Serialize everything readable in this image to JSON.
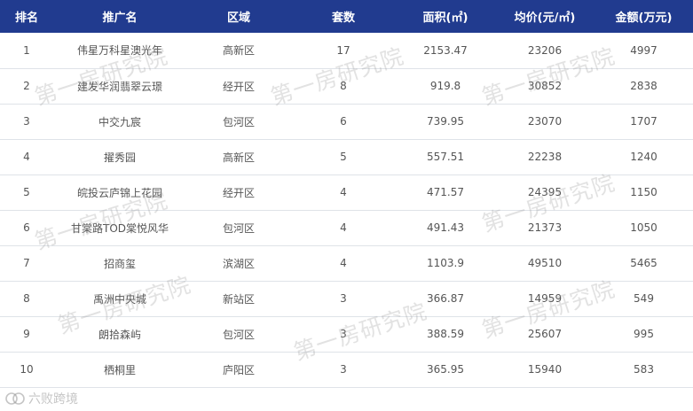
{
  "table": {
    "headers": [
      "排名",
      "推广名",
      "区域",
      "套数",
      "面积(㎡)",
      "均价(元/㎡)",
      "金额(万元)"
    ],
    "rows": [
      [
        "1",
        "伟星万科星澳光年",
        "高新区",
        "17",
        "2153.47",
        "23206",
        "4997"
      ],
      [
        "2",
        "建发华润翡翠云璟",
        "经开区",
        "8",
        "919.8",
        "30852",
        "2838"
      ],
      [
        "3",
        "中交九宸",
        "包河区",
        "6",
        "739.95",
        "23070",
        "1707"
      ],
      [
        "4",
        "擢秀园",
        "高新区",
        "5",
        "557.51",
        "22238",
        "1240"
      ],
      [
        "5",
        "皖投云庐锦上花园",
        "经开区",
        "4",
        "471.57",
        "24395",
        "1150"
      ],
      [
        "6",
        "甘棠路TOD棠悦风华",
        "包河区",
        "4",
        "491.43",
        "21373",
        "1050"
      ],
      [
        "7",
        "招商玺",
        "滨湖区",
        "4",
        "1103.9",
        "49510",
        "5465"
      ],
      [
        "8",
        "禹洲中央城",
        "新站区",
        "3",
        "366.87",
        "14959",
        "549"
      ],
      [
        "9",
        "朗拾森屿",
        "包河区",
        "3",
        "388.59",
        "25607",
        "995"
      ],
      [
        "10",
        "栖桐里",
        "庐阳区",
        "3",
        "365.95",
        "15940",
        "583"
      ]
    ]
  },
  "watermark": {
    "text": "第一房研究院"
  },
  "brand": {
    "text": "六败跨境"
  },
  "colors": {
    "header_bg": "#213b8f",
    "header_text": "#ffffff",
    "cell_text": "#555555",
    "row_border": "#dfe3e8"
  }
}
